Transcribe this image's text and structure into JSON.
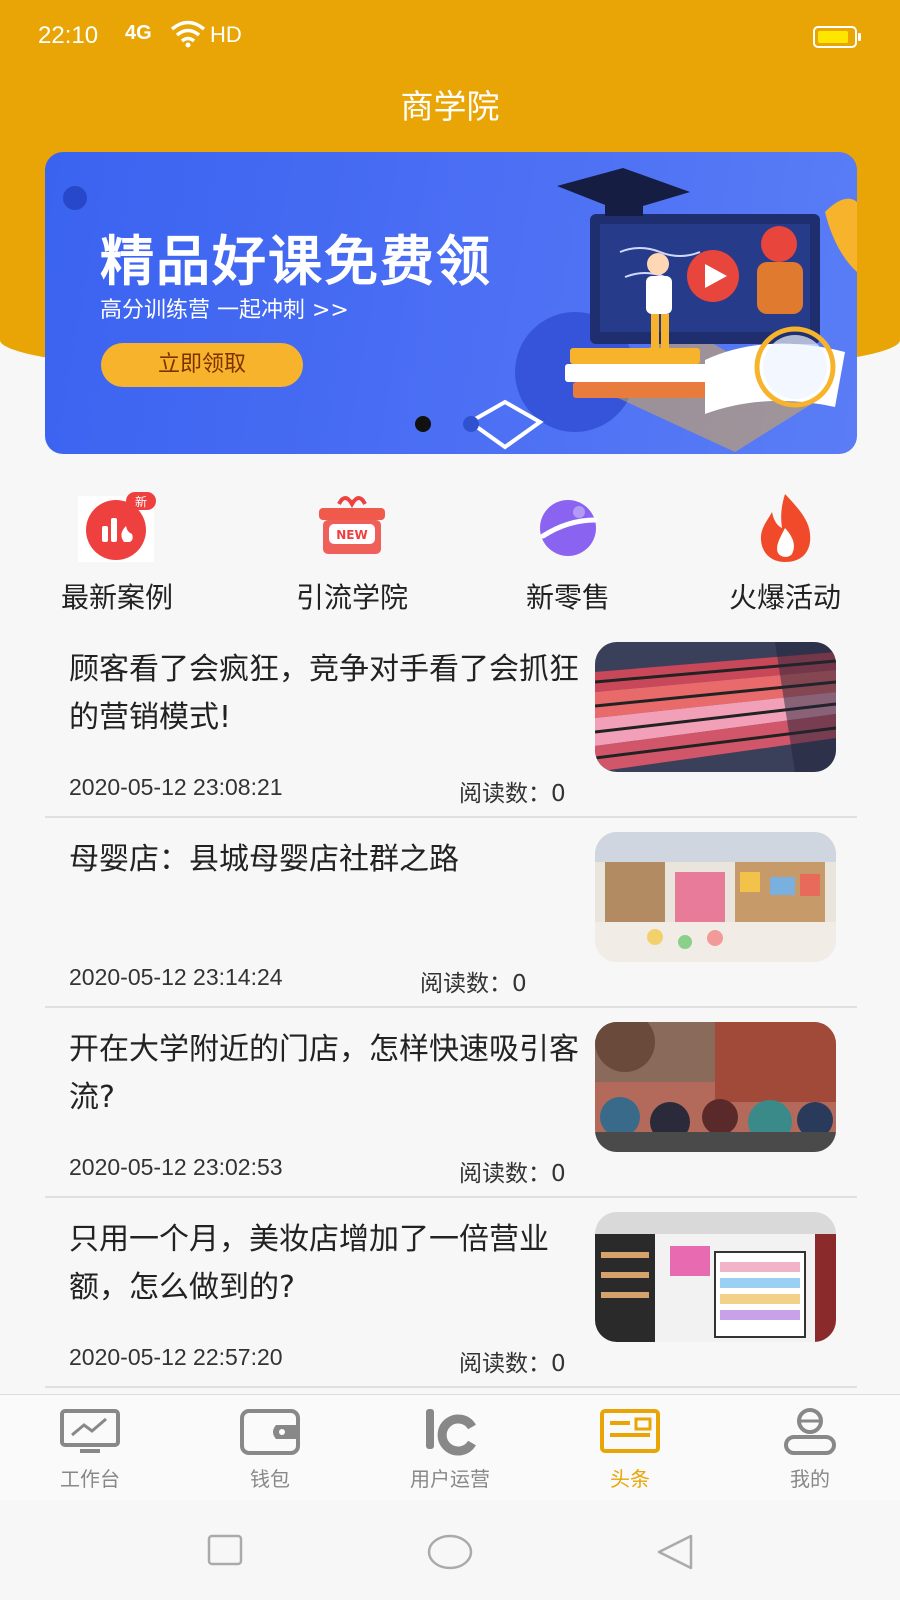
{
  "status_bar": {
    "time": "22:10",
    "signal": "4G",
    "network": "HD"
  },
  "header": {
    "title": "商学院"
  },
  "banner": {
    "title": "精品好课免费领",
    "subtitle": "高分训练营  一起冲刺 >>",
    "button": "立即领取",
    "page_count": 2,
    "active_page": 1
  },
  "quick_menu": [
    {
      "label": "最新案例",
      "icon": "chart-new-icon",
      "badge": "新"
    },
    {
      "label": "引流学院",
      "icon": "gift-new-icon",
      "badge": "NEW"
    },
    {
      "label": "新零售",
      "icon": "planet-icon"
    },
    {
      "label": "火爆活动",
      "icon": "fire-icon"
    }
  ],
  "articles": [
    {
      "title": "顾客看了会疯狂，竞争对手看了会抓狂的营销模式!",
      "date": "2020-05-12 23:08:21",
      "reads": "阅读数：0",
      "thumb": "sneaker-store-photo"
    },
    {
      "title": "母婴店：县城母婴店社群之路",
      "date": "2020-05-12 23:14:24",
      "reads": "阅读数：0",
      "thumb": "baby-store-photo"
    },
    {
      "title": "开在大学附近的门店，怎样快速吸引客流?",
      "date": "2020-05-12 23:02:53",
      "reads": "阅读数：0",
      "thumb": "students-photo"
    },
    {
      "title": "只用一个月，美妆店增加了一倍营业额，怎么做到的?",
      "date": "2020-05-12 22:57:20",
      "reads": "阅读数：0",
      "thumb": "cosmetics-store-photo"
    }
  ],
  "tabbar": [
    {
      "label": "工作台",
      "icon": "monitor-chart-icon",
      "active": false
    },
    {
      "label": "钱包",
      "icon": "wallet-icon",
      "active": false
    },
    {
      "label": "用户运营",
      "icon": "user-ops-icon",
      "active": false
    },
    {
      "label": "头条",
      "icon": "news-card-icon",
      "active": true
    },
    {
      "label": "我的",
      "icon": "profile-icon",
      "active": false
    }
  ],
  "colors": {
    "primary": "#e8a505",
    "banner_blue": "#3a63f0",
    "text": "#222222"
  }
}
